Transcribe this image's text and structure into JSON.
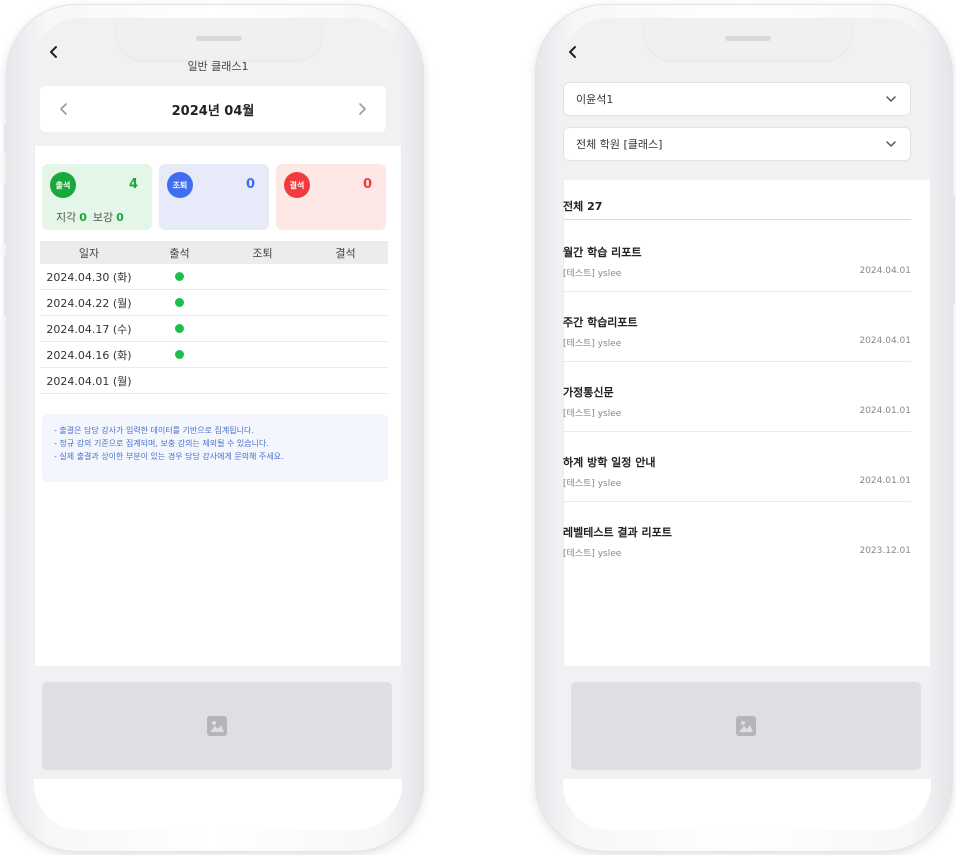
{
  "attendance_screen": {
    "header_title": "일반 클래스1",
    "month_label": "2024년 04월",
    "stats": {
      "attend": {
        "badge": "출석",
        "count": "4",
        "late_label": "지각",
        "late_count": "0",
        "makeup_label": "보강",
        "makeup_count": "0"
      },
      "early": {
        "badge": "조퇴",
        "count": "0"
      },
      "absent": {
        "badge": "결석",
        "count": "0"
      }
    },
    "table": {
      "headers": [
        "일자",
        "출석",
        "조퇴",
        "결석"
      ],
      "rows": [
        {
          "date": "2024.04.30 (화)",
          "attend": true
        },
        {
          "date": "2024.04.22 (월)",
          "attend": true
        },
        {
          "date": "2024.04.17 (수)",
          "attend": true
        },
        {
          "date": "2024.04.16 (화)",
          "attend": true
        },
        {
          "date": "2024.04.01 (월)",
          "attend": false
        }
      ]
    },
    "notice": [
      "- 출결은 담당 강사가 입력한 데이터를 기반으로 집계됩니다.",
      "- 정규 강의 기준으로 집계되며, 보충 강의는 제외될 수 있습니다.",
      "- 실제 출결과 상이한 부분이 있는 경우 담당 강사에게 문의해 주세요."
    ],
    "footer_icon": "image-icon"
  },
  "report_screen": {
    "student_select": "이윤석1",
    "academy_select": "전체 학원 [클래스]",
    "total_label": "전체 27",
    "reports": [
      {
        "title": "월간 학습 리포트",
        "author": "[테스트] yslee",
        "date": "2024.04.01"
      },
      {
        "title": "주간 학습리포트",
        "author": "[테스트] yslee",
        "date": "2024.04.01"
      },
      {
        "title": "가정통신문",
        "author": "[테스트] yslee",
        "date": "2024.01.01"
      },
      {
        "title": "하계 방학 일정 안내",
        "author": "[테스트] yslee",
        "date": "2024.01.01"
      },
      {
        "title": "레벨테스트 결과 리포트",
        "author": "[테스트] yslee",
        "date": "2023.12.01"
      }
    ],
    "footer_icon": "image-icon"
  },
  "colors": {
    "attend": "#19a83c",
    "early": "#3f6ef0",
    "absent": "#ef3d3d",
    "notice_text": "#4a6fc9"
  }
}
